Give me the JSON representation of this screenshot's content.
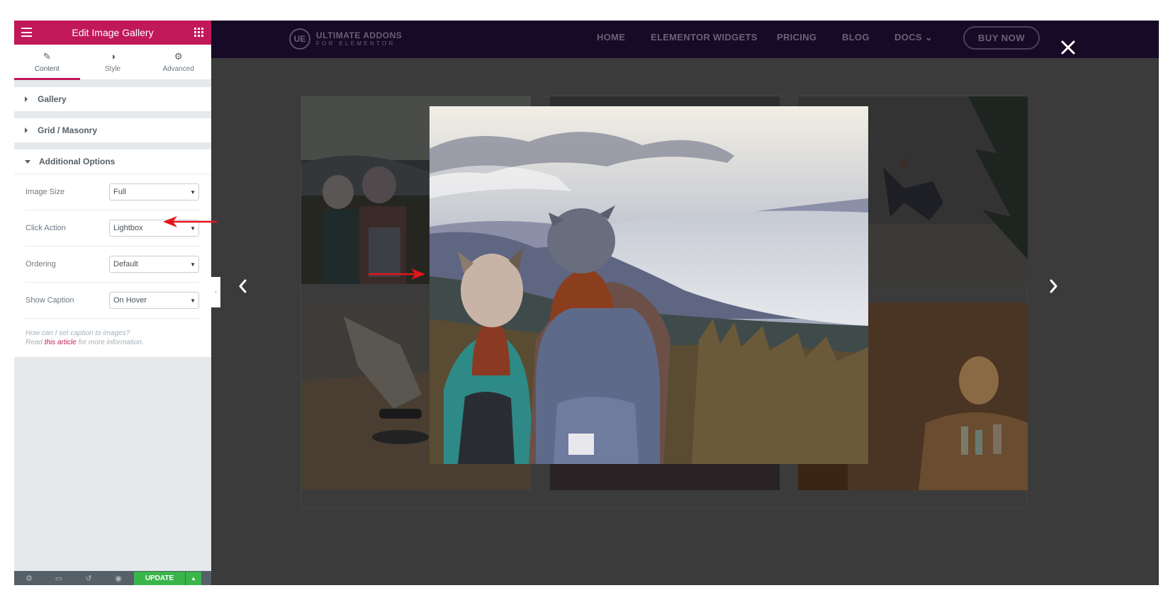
{
  "panel": {
    "title": "Edit Image Gallery",
    "tabs": [
      {
        "label": "Content",
        "icon": "pencil-icon"
      },
      {
        "label": "Style",
        "icon": "half-circle-icon"
      },
      {
        "label": "Advanced",
        "icon": "gear-icon"
      }
    ],
    "sections": {
      "gallery": "Gallery",
      "grid": "Grid / Masonry",
      "additional": "Additional Options"
    },
    "options": [
      {
        "label": "Image Size",
        "value": "Full"
      },
      {
        "label": "Click Action",
        "value": "Lightbox"
      },
      {
        "label": "Ordering",
        "value": "Default"
      },
      {
        "label": "Show Caption",
        "value": "On Hover"
      }
    ],
    "help": {
      "line1": "How can I set caption to images?",
      "line2_pre": "Read ",
      "link": "this article",
      "line2_post": " for more information."
    },
    "footer": {
      "update_label": "UPDATE"
    }
  },
  "site": {
    "logo": {
      "mark": "UE",
      "line1": "ULTIMATE ADDONS",
      "line2": "FOR ELEMENTOR"
    },
    "nav": [
      "HOME",
      "ELEMENTOR WIDGETS",
      "PRICING",
      "BLOG",
      "DOCS"
    ],
    "docs_chevron": "⌄",
    "cta": "BUY NOW"
  },
  "colors": {
    "accent": "#c1185a",
    "update": "#39b54a",
    "nav_bg": "#160a26",
    "annotation": "#e3161b"
  }
}
